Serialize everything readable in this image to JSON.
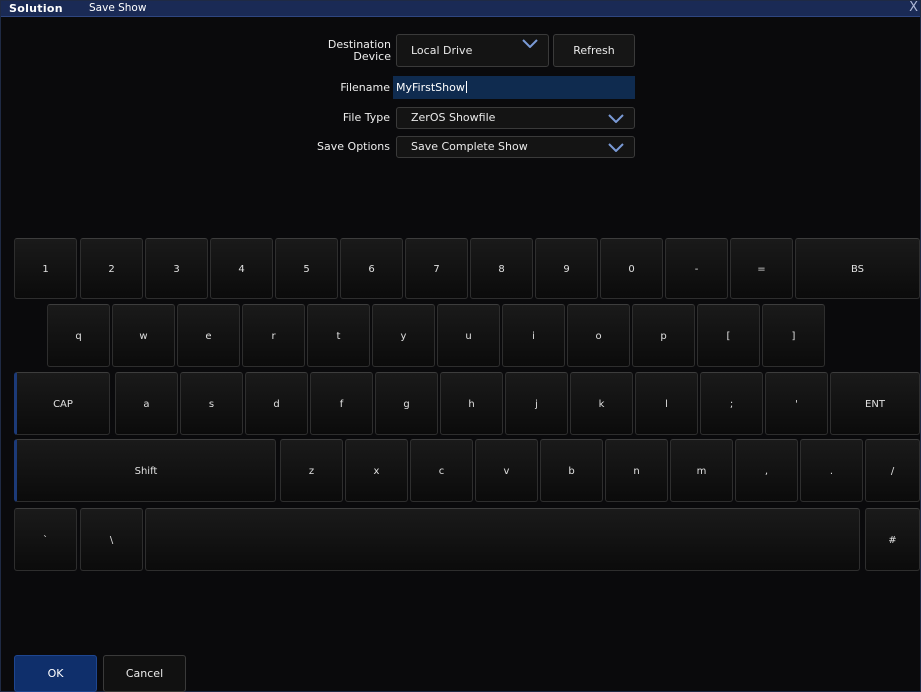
{
  "titlebar": {
    "brand": "Solution",
    "title": "Save Show",
    "close": "X"
  },
  "form": {
    "destination_label_1": "Destination",
    "destination_label_2": "Device",
    "destination_value": "Local Drive",
    "refresh_label": "Refresh",
    "filename_label": "Filename",
    "filename_value": "MyFirstShow",
    "filetype_label": "File Type",
    "filetype_value": "ZerOS Showfile",
    "saveoptions_label": "Save Options",
    "saveoptions_value": "Save Complete Show"
  },
  "keyboard": {
    "row1": [
      "1",
      "2",
      "3",
      "4",
      "5",
      "6",
      "7",
      "8",
      "9",
      "0",
      "-",
      "=",
      "BS"
    ],
    "row2": [
      "q",
      "w",
      "e",
      "r",
      "t",
      "y",
      "u",
      "i",
      "o",
      "p",
      "[",
      "]"
    ],
    "row3": [
      "CAP",
      "a",
      "s",
      "d",
      "f",
      "g",
      "h",
      "j",
      "k",
      "l",
      ";",
      "'",
      "ENT"
    ],
    "row4": [
      "Shift",
      "z",
      "x",
      "c",
      "v",
      "b",
      "n",
      "m",
      ",",
      ".",
      "/"
    ],
    "row5": [
      "`",
      "\\",
      "",
      "#"
    ]
  },
  "footer": {
    "ok_label": "OK",
    "cancel_label": "Cancel"
  },
  "colors": {
    "accent": "#0f2f6b",
    "titlebar": "#1a2a55",
    "field_highlight": "#0f2b4f"
  }
}
